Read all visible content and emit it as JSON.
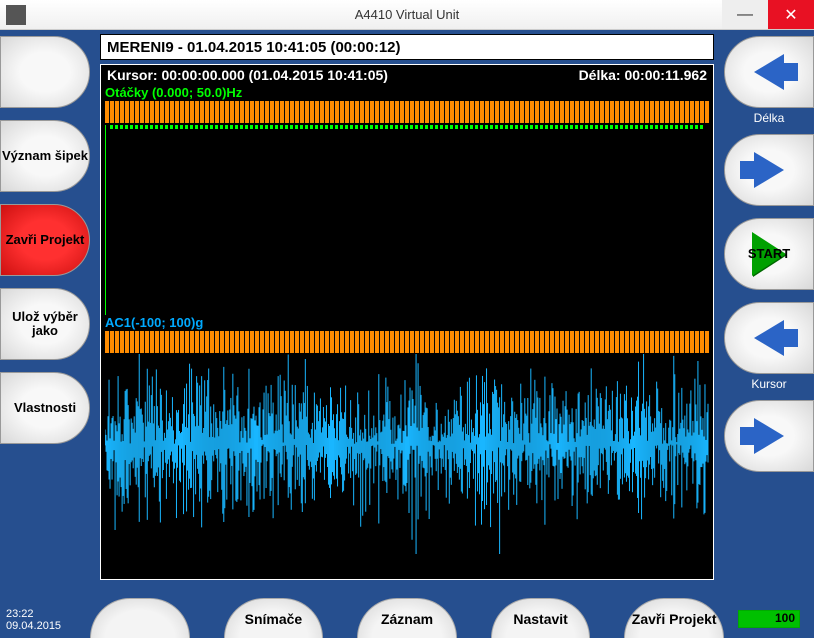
{
  "window": {
    "title": "A4410 Virtual Unit"
  },
  "header": "MERENI9 - 01.04.2015 10:41:05 (00:00:12)",
  "info": {
    "kursor": "Kursor: 00:00:00.000 (01.04.2015 10:41:05)",
    "delka": "Délka: 00:00:11.962"
  },
  "series": {
    "top": "Otáčky (0.000; 50.0)Hz",
    "bottom": "AC1(-100; 100)g"
  },
  "left_buttons": {
    "b1": "",
    "b2": "Význam šipek",
    "b3": "Zavři Projekt",
    "b4": "Ulož výběr jako",
    "b5": "Vlastnosti"
  },
  "right_buttons": {
    "b1": "",
    "b1_caption": "Délka",
    "b2": "",
    "b3": "START",
    "b4": "",
    "b4_caption": "Kursor",
    "b5": ""
  },
  "tabs": {
    "t1": "",
    "t2": "Snímače",
    "t3": "Záznam",
    "t4": "Nastavit",
    "t5": "Zavři Projekt"
  },
  "clock": {
    "time": "23:22",
    "date": "09.04.2015"
  },
  "battery": "100"
}
